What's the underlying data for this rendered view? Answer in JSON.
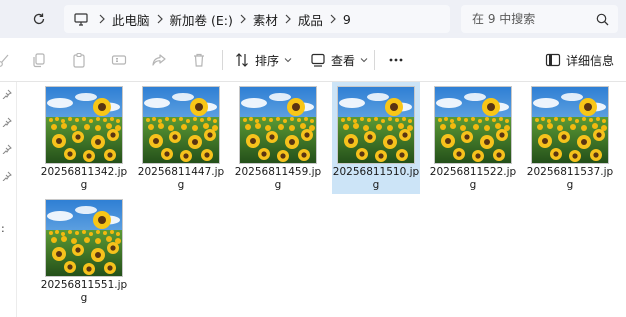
{
  "breadcrumb": [
    {
      "label": "此电脑"
    },
    {
      "label": "新加卷 (E:)"
    },
    {
      "label": "素材"
    },
    {
      "label": "成品"
    },
    {
      "label": "9"
    }
  ],
  "search": {
    "placeholder": "在 9 中搜索"
  },
  "toolbar": {
    "sort_label": "排序",
    "view_label": "查看",
    "details_label": "详细信息"
  },
  "files": [
    {
      "name": "20256811342.jpg",
      "selected": false
    },
    {
      "name": "20256811447.jpg",
      "selected": false
    },
    {
      "name": "20256811459.jpg",
      "selected": false
    },
    {
      "name": "20256811510.jpg",
      "selected": true
    },
    {
      "name": "20256811522.jpg",
      "selected": false
    },
    {
      "name": "20256811537.jpg",
      "selected": false
    },
    {
      "name": "20256811551.jpg",
      "selected": false
    }
  ],
  "nav_strip": {
    "colon": ":"
  },
  "colors": {
    "selection": "#cce4f7",
    "address_bg": "#eef0f6",
    "sky": "#4f9fe0",
    "sunflower": "#f4c01a",
    "field": "#3f7d2a"
  },
  "icons": {
    "refresh": "refresh-icon",
    "monitor": "monitor-icon",
    "chevron": "chevron-right-icon",
    "search": "search-icon",
    "cut": "cut-icon",
    "copy": "copy-icon",
    "paste": "paste-icon",
    "rename": "rename-icon",
    "share": "share-icon",
    "delete": "delete-icon",
    "sort": "sort-icon",
    "view": "view-icon",
    "more": "more-icon",
    "details": "details-pane-icon",
    "pin": "pin-icon"
  }
}
